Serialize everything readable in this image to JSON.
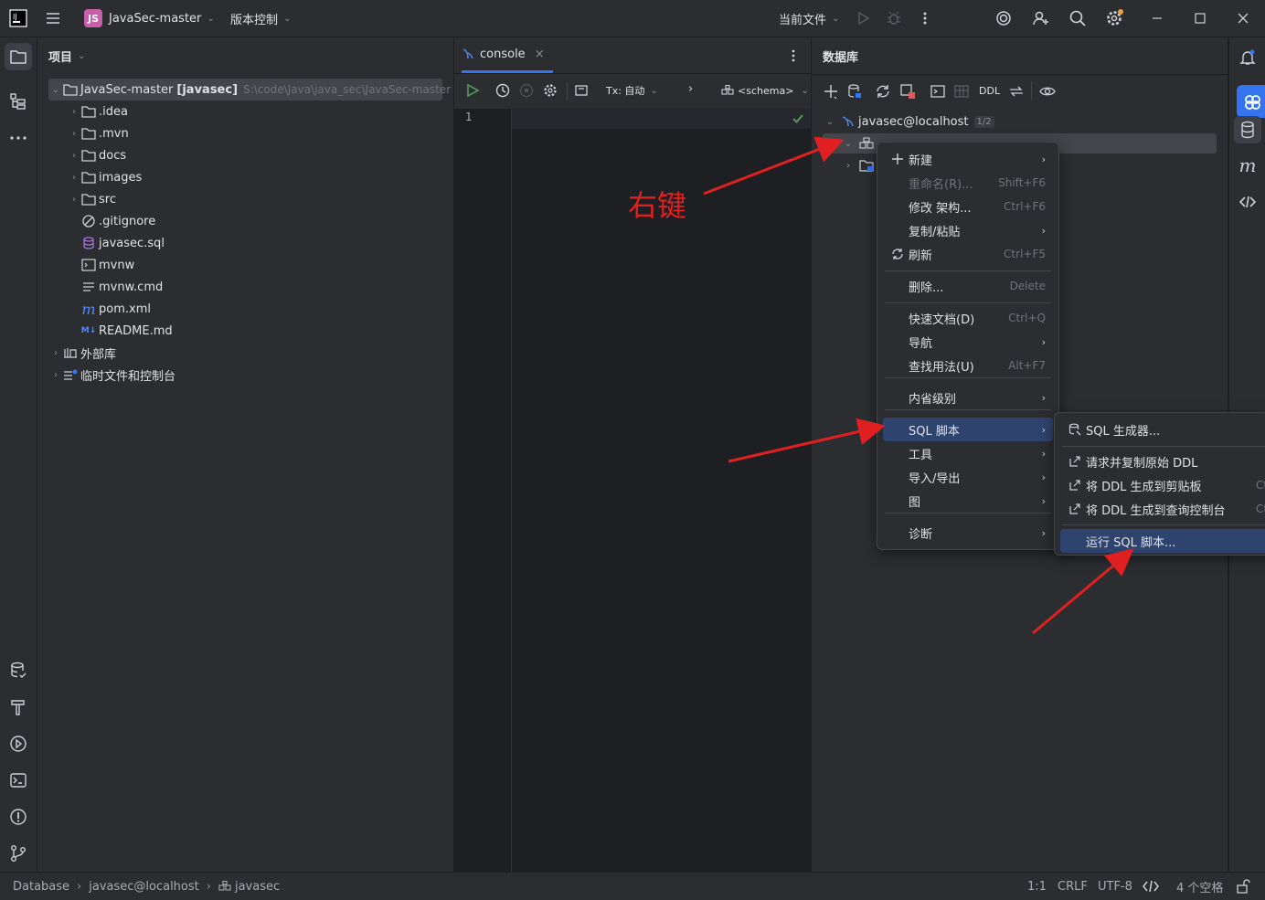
{
  "titlebar": {
    "project_badge": "JS",
    "project_name": "JavaSec-master",
    "vcs_label": "版本控制",
    "run_config": "当前文件"
  },
  "project_panel": {
    "title": "项目",
    "root": {
      "name": "JavaSec-master",
      "module": "[javasec]",
      "path": "S:\\code\\Java\\java_sec\\JavaSec-master"
    },
    "items": [
      {
        "name": ".idea",
        "icon": "folder-icon",
        "expandable": true
      },
      {
        "name": ".mvn",
        "icon": "folder-icon",
        "expandable": true
      },
      {
        "name": "docs",
        "icon": "folder-icon",
        "expandable": true
      },
      {
        "name": "images",
        "icon": "folder-icon",
        "expandable": true
      },
      {
        "name": "src",
        "icon": "folder-icon",
        "expandable": true
      },
      {
        "name": ".gitignore",
        "icon": "ignore-file-icon",
        "expandable": false
      },
      {
        "name": "javasec.sql",
        "icon": "sql-file-icon",
        "expandable": false
      },
      {
        "name": "mvnw",
        "icon": "shell-file-icon",
        "expandable": false
      },
      {
        "name": "mvnw.cmd",
        "icon": "text-file-icon",
        "expandable": false
      },
      {
        "name": "pom.xml",
        "icon": "maven-icon",
        "expandable": false
      },
      {
        "name": "README.md",
        "icon": "markdown-icon",
        "expandable": false
      }
    ],
    "external_libs": "外部库",
    "scratches": "临时文件和控制台"
  },
  "editor": {
    "tab_label": "console",
    "tx_label": "Tx: 自动",
    "schema_label": "<schema>",
    "line_number": "1"
  },
  "db_panel": {
    "title": "数据库",
    "ddl_label": "DDL",
    "connection": "javasec@localhost",
    "connection_count": "1/2"
  },
  "annotation": {
    "text": "右键",
    "color": "#e02020"
  },
  "context_menu": {
    "items": [
      {
        "label": "新建",
        "shortcut": "",
        "submenu": true,
        "icon": "plus-icon"
      },
      {
        "label": "重命名(R)...",
        "shortcut": "Shift+F6",
        "disabled": true
      },
      {
        "label": "修改 架构...",
        "shortcut": "Ctrl+F6"
      },
      {
        "label": "复制/粘贴",
        "shortcut": "",
        "submenu": true
      },
      {
        "label": "刷新",
        "shortcut": "Ctrl+F5",
        "icon": "refresh-icon"
      },
      {
        "label": "删除...",
        "shortcut": "Delete"
      },
      {
        "label": "快速文档(D)",
        "shortcut": "Ctrl+Q"
      },
      {
        "label": "导航",
        "shortcut": "",
        "submenu": true
      },
      {
        "label": "查找用法(U)",
        "shortcut": "Alt+F7"
      },
      {
        "label": "内省级别",
        "shortcut": "",
        "submenu": true
      },
      {
        "label": "SQL 脚本",
        "shortcut": "",
        "submenu": true,
        "selected": true
      },
      {
        "label": "工具",
        "shortcut": "",
        "submenu": true
      },
      {
        "label": "导入/导出",
        "shortcut": "",
        "submenu": true
      },
      {
        "label": "图",
        "shortcut": "",
        "submenu": true
      },
      {
        "label": "诊断",
        "shortcut": "",
        "submenu": true
      }
    ]
  },
  "submenu": {
    "items": [
      {
        "label": "SQL 生成器...",
        "shortcut": "",
        "icon": "sql-generator-icon"
      },
      {
        "label": "请求并复制原始 DDL",
        "shortcut": "",
        "icon": "external-link-icon"
      },
      {
        "label": "将 DDL 生成到剪贴板",
        "shortcut": "Ctr",
        "icon": "external-link-icon"
      },
      {
        "label": "将 DDL 生成到查询控制台",
        "shortcut": "Ctr",
        "icon": "external-link-icon"
      },
      {
        "label": "运行 SQL 脚本...",
        "shortcut": "",
        "selected": true
      }
    ]
  },
  "statusbar": {
    "crumb1": "Database",
    "crumb2": "javasec@localhost",
    "crumb3": "javasec",
    "position": "1:1",
    "line_sep": "CRLF",
    "encoding": "UTF-8",
    "indent": "4 个空格"
  }
}
